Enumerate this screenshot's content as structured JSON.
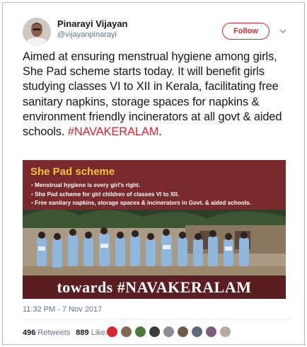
{
  "author": {
    "display_name": "Pinarayi Vijayan",
    "handle": "@vijayanpinarayi"
  },
  "follow_label": "Follow",
  "tweet": {
    "text": "Aimed at ensuring menstrual hygiene among girls, She Pad scheme starts today. It will benefit girls studying classes VI to XII in Kerala, facilitating free sanitary napkins, storage spaces for napkins & environment friendly incinerators at all govt & aided schools.",
    "hashtag": "#NAVAKERALAM",
    "trailing": "."
  },
  "media": {
    "title": "She Pad scheme",
    "bullets": [
      "Menstrual hygiene is every girl's right.",
      "She Pad scheme for girl children of classes VI to XII.",
      "Free sanitary napkins, storage spaces & incinerators in Govt. & aided schools."
    ],
    "footer": "towards #NAVAKERALAM"
  },
  "timestamp": "11:32 PM - 7 Nov 2017",
  "stats": {
    "retweets_count": "496",
    "retweets_label": "Retweets",
    "likes_count": "889",
    "likes_label": "Likes"
  },
  "likers": [
    "#d9252b",
    "#7c6a55",
    "#4f7a3e",
    "#3c3a38",
    "#8a8d91",
    "#6e5b4a",
    "#5d6b78",
    "#7d5c7a",
    "#b9aaa0"
  ],
  "colors": {
    "accent": "#d8262e",
    "secondary_text": "#657786",
    "media_background": "#7a2a2d",
    "media_title": "#f4c23a"
  }
}
